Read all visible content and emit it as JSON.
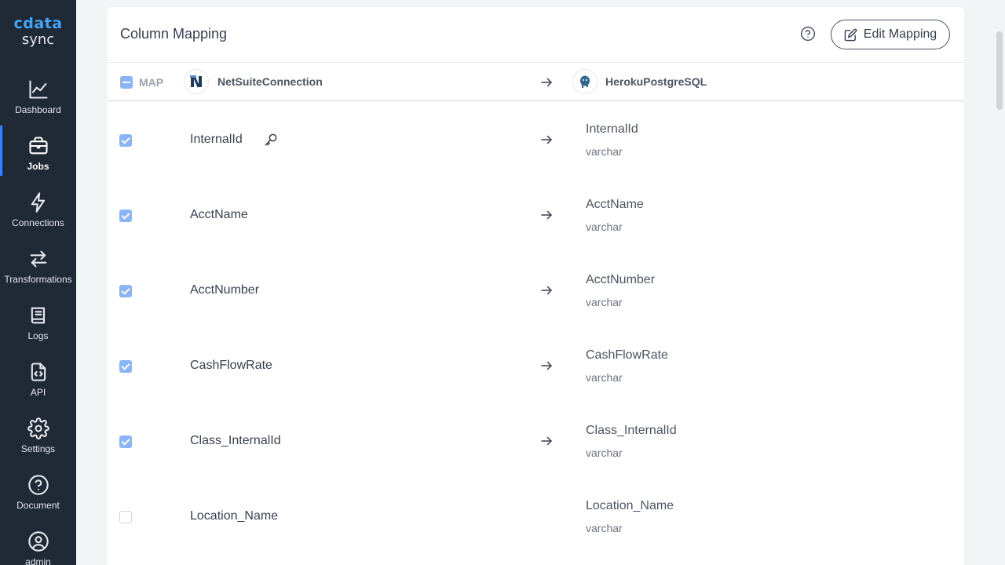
{
  "app": {
    "brand": "cdata",
    "product": "sync"
  },
  "sidebar": {
    "items": [
      {
        "label": "Dashboard",
        "icon": "chart-line-icon",
        "active": false
      },
      {
        "label": "Jobs",
        "icon": "briefcase-icon",
        "active": true
      },
      {
        "label": "Connections",
        "icon": "lightning-icon",
        "active": false
      },
      {
        "label": "Transformations",
        "icon": "arrows-swap-icon",
        "active": false
      },
      {
        "label": "Logs",
        "icon": "book-icon",
        "active": false
      },
      {
        "label": "API",
        "icon": "code-file-icon",
        "active": false
      },
      {
        "label": "Settings",
        "icon": "gear-icon",
        "active": false
      },
      {
        "label": "Document",
        "icon": "question-circle-icon",
        "active": false
      },
      {
        "label": "admin",
        "icon": "user-circle-icon",
        "active": false
      }
    ]
  },
  "main": {
    "title": "Column Mapping",
    "edit_button": "Edit Mapping",
    "header": {
      "map_label": "MAP",
      "source": "NetSuiteConnection",
      "destination": "HerokuPostgreSQL"
    },
    "rows": [
      {
        "source": "InternalId",
        "dest": "InternalId",
        "type": "varchar",
        "checked": true,
        "key": true
      },
      {
        "source": "AcctName",
        "dest": "AcctName",
        "type": "varchar",
        "checked": true,
        "key": false
      },
      {
        "source": "AcctNumber",
        "dest": "AcctNumber",
        "type": "varchar",
        "checked": true,
        "key": false
      },
      {
        "source": "CashFlowRate",
        "dest": "CashFlowRate",
        "type": "varchar",
        "checked": true,
        "key": false
      },
      {
        "source": "Class_InternalId",
        "dest": "Class_InternalId",
        "type": "varchar",
        "checked": true,
        "key": false
      },
      {
        "source": "Location_Name",
        "dest": "Location_Name",
        "type": "varchar",
        "checked": false,
        "key": false
      }
    ]
  },
  "colors": {
    "sidebar_bg": "#1f2a36",
    "brand": "#42a5f5",
    "checkbox": "#8ab4f8",
    "active_indicator": "#3b82f6"
  }
}
